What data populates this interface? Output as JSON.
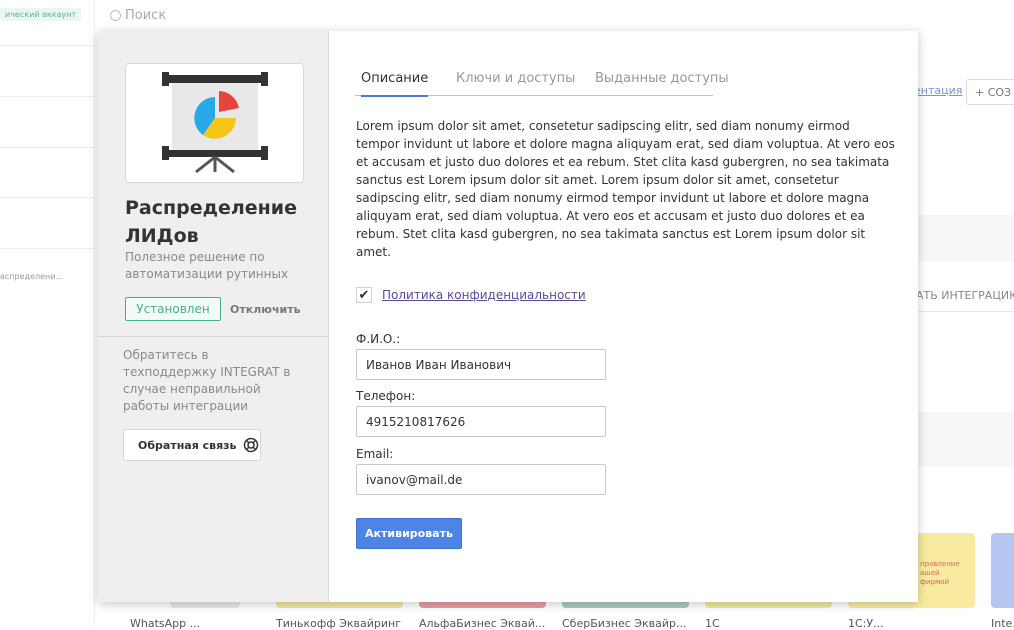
{
  "background": {
    "account_badge": "ический аккаунт",
    "sidebar_small_text": "аспределени...",
    "search_placeholder": "Поиск",
    "documentation_link": "ентация",
    "create_button": "+ СОЗ",
    "create_integration": "АТЬ ИНТЕГРАЦИЮ",
    "card_text": "правление\nашей\nфирмой",
    "bottom_cards": [
      "WhatsApp ...",
      "Тинькофф Эквайринг",
      "АльфаБизнес Эквай...",
      "СберБизнес Эквайр...",
      "1С",
      "1С:У...",
      "Inte..."
    ]
  },
  "modal": {
    "app_title": "Распределение ЛИДов",
    "app_subtitle": "Полезное решение по автоматизации рутинных",
    "installed_label": "Установлен",
    "disable_label": "Отключить",
    "support_text": "Обратитесь в техподдержку INTEGRAT в случае неправильной работы интеграции",
    "feedback_label": "Обратная связь",
    "tabs": [
      {
        "label": "Описание",
        "active": true
      },
      {
        "label": "Ключи и доступы",
        "active": false
      },
      {
        "label": "Выданные доступы",
        "active": false
      }
    ],
    "description": "Lorem ipsum dolor sit amet, consetetur sadipscing elitr, sed diam nonumy eirmod tempor invidunt ut labore et dolore magna aliquyam erat, sed diam voluptua. At vero eos et accusam et justo duo dolores et ea rebum. Stet clita kasd gubergren, no sea takimata sanctus est Lorem ipsum dolor sit amet. Lorem ipsum dolor sit amet, consetetur sadipscing elitr, sed diam nonumy eirmod tempor invidunt ut labore et dolore magna aliquyam erat, sed diam voluptua. At vero eos et accusam et justo duo dolores et ea rebum. Stet clita kasd gubergren, no sea takimata sanctus est Lorem ipsum dolor sit amet.",
    "privacy_checked": true,
    "privacy_label": "Политика конфиденциальности",
    "fields": {
      "name_label": "Ф.И.О.:",
      "name_value": "Иванов Иван Иванович",
      "phone_label": "Телефон:",
      "phone_value": "4915210817626",
      "email_label": "Email:",
      "email_value": "ivanov@mail.de"
    },
    "activate_label": "Активировать"
  },
  "colors": {
    "accent": "#4d85e6",
    "installed": "#48b088",
    "link": "#5a4a9e"
  },
  "icons": [
    "presentation-chart-icon",
    "lifebuoy-icon",
    "search-icon",
    "checkmark-icon"
  ]
}
